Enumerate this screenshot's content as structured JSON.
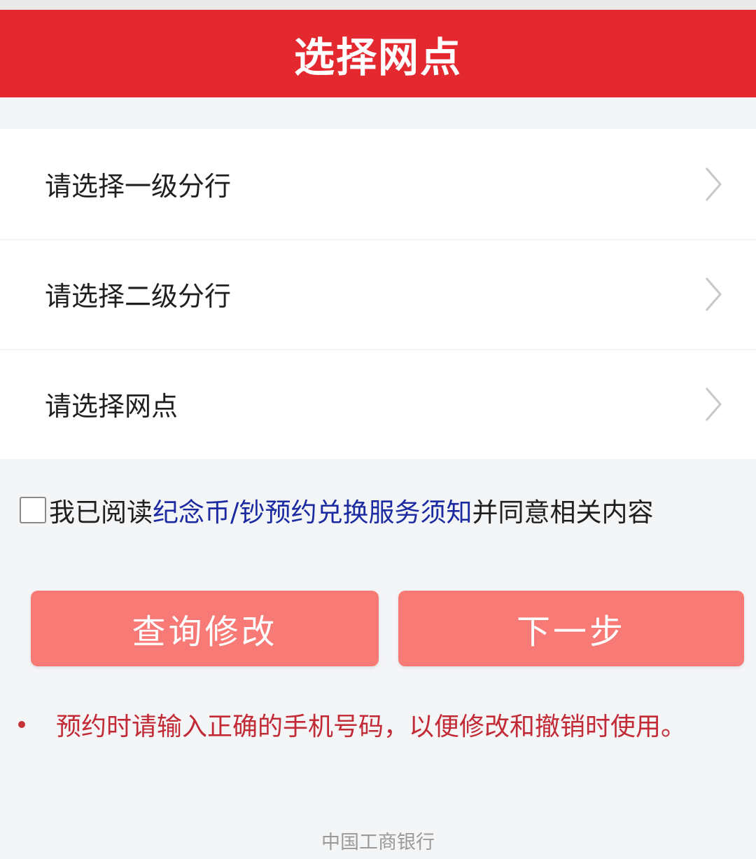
{
  "header": {
    "title": "选择网点"
  },
  "list": {
    "items": [
      {
        "label": "请选择一级分行"
      },
      {
        "label": "请选择二级分行"
      },
      {
        "label": "请选择网点"
      }
    ]
  },
  "agreement": {
    "checked": false,
    "prefix": "我已阅读",
    "link": "纪念币/钞预约兑换服务须知",
    "suffix": "并同意相关内容"
  },
  "buttons": {
    "query_label": "查询修改",
    "next_label": "下一步"
  },
  "notice": {
    "text": "预约时请输入正确的手机号码，以便修改和撤销时使用。"
  },
  "footer": {
    "text": "中国工商银行"
  },
  "colors": {
    "header_bg": "#e3292f",
    "button_bg": "#f77a76",
    "link": "#1b2aa0",
    "notice": "#c22a36"
  },
  "icons": {
    "row_chevron": "chevron-right-icon"
  }
}
